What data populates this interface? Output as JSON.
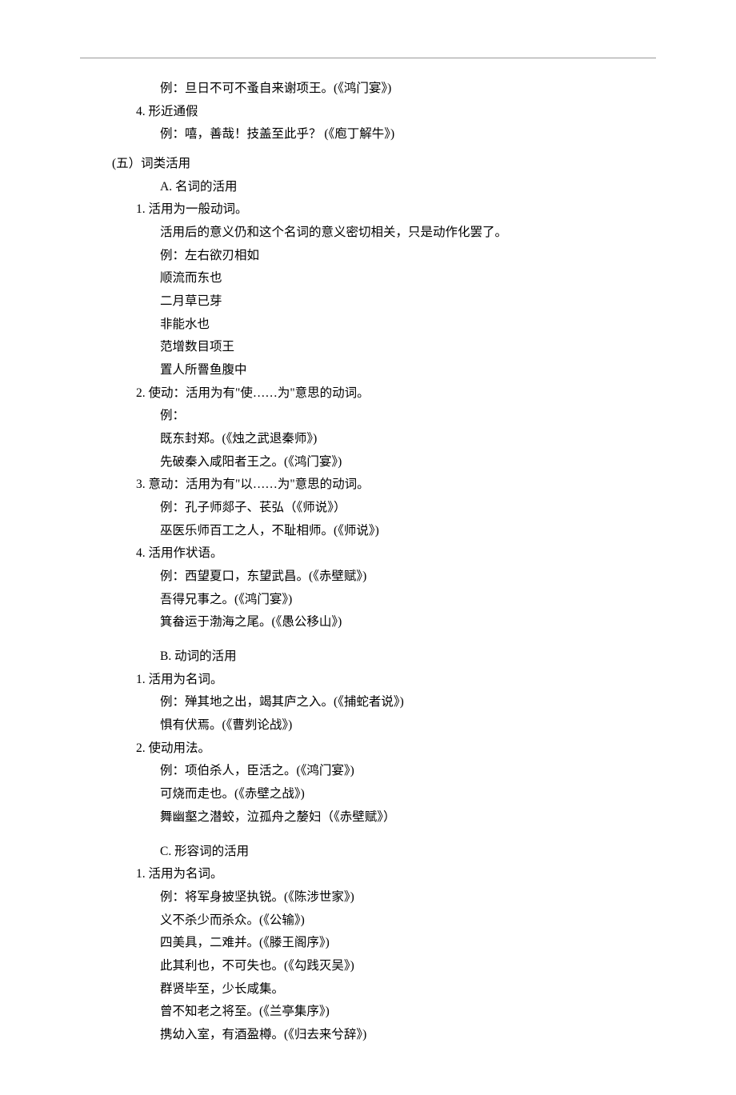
{
  "top": {
    "exA": "例：旦日不可不蚤自来谢项王。(《鸿门宴》)",
    "item4": "4. 形近通假",
    "exB": "例：嘻，善哉！技盖至此乎？ (《庖丁解牛》)"
  },
  "section5": {
    "title": "(五）词类活用",
    "A": {
      "header": "A. 名词的活用",
      "i1": {
        "num": "1. 活用为一般动词。",
        "desc": "活用后的意义仍和这个名词的意义密切相关，只是动作化罢了。",
        "ex": "例：左右欲刃相如",
        "e1": "顺流而东也",
        "e2": "二月草已芽",
        "e3": "非能水也",
        "e4": "范增数目项王",
        "e5": "置人所罾鱼腹中"
      },
      "i2": {
        "num": "2. 使动：活用为有\"使……为\"意思的动词。",
        "ex": "例：",
        "e1": "既东封郑。(《烛之武退秦师》)",
        "e2": "先破秦入咸阳者王之。(《鸿门宴》)"
      },
      "i3": {
        "num": "3. 意动：活用为有\"以……为\"意思的动词。",
        "ex": "例：孔子师郯子、苌弘（《师说》）",
        "e1": "巫医乐师百工之人，不耻相师。(《师说》)"
      },
      "i4": {
        "num": "4. 活用作状语。",
        "ex": "例：西望夏口，东望武昌。(《赤壁赋》)",
        "e1": "吾得兄事之。(《鸿门宴》)",
        "e2": "箕畚运于渤海之尾。(《愚公移山》)"
      }
    },
    "B": {
      "header": "B. 动词的活用",
      "i1": {
        "num": "1. 活用为名词。",
        "ex": "例：殚其地之出，竭其庐之入。(《捕蛇者说》)",
        "e1": "惧有伏焉。(《曹刿论战》)"
      },
      "i2": {
        "num": "2. 使动用法。",
        "ex": "例：项伯杀人，臣活之。(《鸿门宴》)",
        "e1": "可烧而走也。(《赤壁之战》)",
        "e2": "舞幽壑之潜蛟，泣孤舟之嫠妇（《赤壁赋》）"
      }
    },
    "C": {
      "header": "C. 形容词的活用",
      "i1": {
        "num": "1. 活用为名词。",
        "ex": "例：将军身披坚执锐。(《陈涉世家》)",
        "e1": "义不杀少而杀众。(《公输》)",
        "e2": "四美具，二难并。(《滕王阁序》)",
        "e3": "此其利也，不可失也。(《勾践灭吴》)",
        "e4": "群贤毕至，少长咸集。",
        "e5": "曾不知老之将至。(《兰亭集序》)",
        "e6": "携幼入室，有酒盈樽。(《归去来兮辞》)"
      }
    }
  }
}
